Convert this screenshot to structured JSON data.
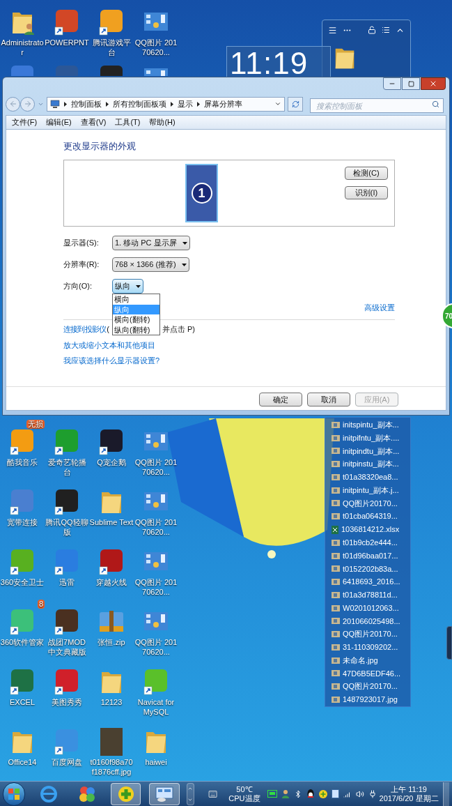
{
  "desktop_icons_top": [
    {
      "label": "Administrator",
      "kind": "user_folder"
    },
    {
      "label": "POWERPNT",
      "kind": "shortcut",
      "color": "#d24726"
    },
    {
      "label": "腾讯游戏平台",
      "kind": "shortcut",
      "color": "#f0a020"
    },
    {
      "label": "QQ图片 20170620...",
      "kind": "image"
    }
  ],
  "desktop_icons_partial": [
    {
      "kind": "shortcut",
      "color": "#3a78d8"
    },
    {
      "kind": "shortcut",
      "color": "#2b5797"
    },
    {
      "kind": "shortcut",
      "color": "#222222"
    },
    {
      "kind": "image"
    }
  ],
  "clock_widget": {
    "time": "11:19"
  },
  "window": {
    "breadcrumb": [
      "控制面板",
      "所有控制面板项",
      "显示",
      "屏幕分辨率"
    ],
    "search": {
      "placeholder": "搜索控制面板"
    },
    "menu": [
      "文件(F)",
      "编辑(E)",
      "查看(V)",
      "工具(T)",
      "帮助(H)"
    ],
    "heading": "更改显示器的外观",
    "monitor_number": "1",
    "preview_buttons": [
      "检测(C)",
      "识别(I)"
    ],
    "fields": [
      {
        "label": "显示器(S):",
        "value": "1. 移动 PC 显示屏",
        "expanded": false
      },
      {
        "label": "分辨率(R):",
        "value": "768 × 1366 (推荐)",
        "expanded": false
      },
      {
        "label": "方向(O):",
        "value": "纵向",
        "expanded": true,
        "options": [
          {
            "label": "横向",
            "selected": false
          },
          {
            "label": "纵向",
            "selected": true
          },
          {
            "label": "横向(翻转)",
            "selected": false
          },
          {
            "label": "纵向(翻转)",
            "selected": false
          }
        ]
      }
    ],
    "advanced_link": "高级设置",
    "projector": {
      "link": "连接到投影仪",
      "text_before": "(",
      "text_after": "并点击 P)"
    },
    "links": [
      "放大或缩小文本和其他项目",
      "我应该选择什么显示器设置?"
    ],
    "buttons": [
      {
        "label": "确定",
        "disabled": false
      },
      {
        "label": "取消",
        "disabled": false
      },
      {
        "label": "应用(A)",
        "disabled": true
      }
    ]
  },
  "side_badge": "70",
  "desktop_icons_bottom": [
    {
      "label": "酷我音乐",
      "kind": "shortcut",
      "color": "#f39c12",
      "badge": "无损"
    },
    {
      "label": "爱奇艺轮播台",
      "kind": "shortcut",
      "color": "#1e9e2e"
    },
    {
      "label": "Q宠企鹅",
      "kind": "shortcut",
      "color": "#1a1a2a"
    },
    {
      "label": "QQ图片 20170620...",
      "kind": "image"
    },
    {
      "label": "宽带连接",
      "kind": "shortcut",
      "color": "#4a7fd0"
    },
    {
      "label": "腾讯QQ轻聊版",
      "kind": "shortcut",
      "color": "#202020"
    },
    {
      "label": "Sublime Text",
      "kind": "folder"
    },
    {
      "label": "QQ图片 20170620...",
      "kind": "image"
    },
    {
      "label": "360安全卫士",
      "kind": "shortcut",
      "color": "#58b020"
    },
    {
      "label": "迅雷",
      "kind": "shortcut",
      "color": "#2a7de0"
    },
    {
      "label": "穿越火线",
      "kind": "shortcut",
      "color": "#b01818"
    },
    {
      "label": "QQ图片 20170620...",
      "kind": "image"
    },
    {
      "label": "360软件管家",
      "kind": "shortcut",
      "color": "#3cc07a",
      "badge": "8"
    },
    {
      "label": "战团7MOD中文典藏版",
      "kind": "shortcut",
      "color": "#4a3020"
    },
    {
      "label": "张恒.zip",
      "kind": "zip"
    },
    {
      "label": "QQ图片 20170620...",
      "kind": "image"
    },
    {
      "label": "EXCEL",
      "kind": "shortcut",
      "color": "#1e7145"
    },
    {
      "label": "美图秀秀",
      "kind": "shortcut",
      "color": "#d0202a"
    },
    {
      "label": "12123",
      "kind": "folder"
    },
    {
      "label": "Navicat for MySQL",
      "kind": "shortcut",
      "color": "#5ac02a"
    },
    {
      "label": "Office14",
      "kind": "folder"
    },
    {
      "label": "百度网盘",
      "kind": "shortcut",
      "color": "#3a90e0"
    },
    {
      "label": "t0160f98a70f1876cff.jpg",
      "kind": "photo"
    },
    {
      "label": "haiwei",
      "kind": "folder"
    }
  ],
  "file_list": [
    {
      "name": "initspintu_副本...",
      "kind": "image"
    },
    {
      "name": "initpifntu_副本....",
      "kind": "image"
    },
    {
      "name": "initpindtu_副本...",
      "kind": "image"
    },
    {
      "name": "initpinstu_副本...",
      "kind": "image"
    },
    {
      "name": "t01a38320ea8...",
      "kind": "image"
    },
    {
      "name": "initpintu_副本.j...",
      "kind": "image"
    },
    {
      "name": "QQ图片20170...",
      "kind": "image"
    },
    {
      "name": "t01cba064319...",
      "kind": "image"
    },
    {
      "name": "1036814212.xlsx",
      "kind": "spreadsheet"
    },
    {
      "name": "t01b9cb2e444...",
      "kind": "image"
    },
    {
      "name": "t01d96baa017...",
      "kind": "image"
    },
    {
      "name": "t0152202b83a...",
      "kind": "image"
    },
    {
      "name": "6418693_2016...",
      "kind": "image"
    },
    {
      "name": "t01a3d78811d...",
      "kind": "image"
    },
    {
      "name": "W0201012063...",
      "kind": "image"
    },
    {
      "name": "201066025498...",
      "kind": "image"
    },
    {
      "name": "QQ图片20170...",
      "kind": "image"
    },
    {
      "name": "31-110309202...",
      "kind": "image"
    },
    {
      "name": "未命名.jpg",
      "kind": "image"
    },
    {
      "name": "47D6B5EDF46...",
      "kind": "image"
    },
    {
      "name": "QQ图片20170...",
      "kind": "image"
    },
    {
      "name": "1487923017.jpg",
      "kind": "image"
    }
  ],
  "taskbar": {
    "buttons": [
      {
        "kind": "browser",
        "active": false
      },
      {
        "kind": "pinwheel",
        "active": false
      },
      {
        "kind": "security",
        "active": true
      },
      {
        "kind": "control_panel",
        "active": true
      }
    ],
    "cpu_temp": "50℃",
    "cpu_label": "CPU温度",
    "time": "上午 11:19",
    "date": "2017/6/20 星期二"
  }
}
